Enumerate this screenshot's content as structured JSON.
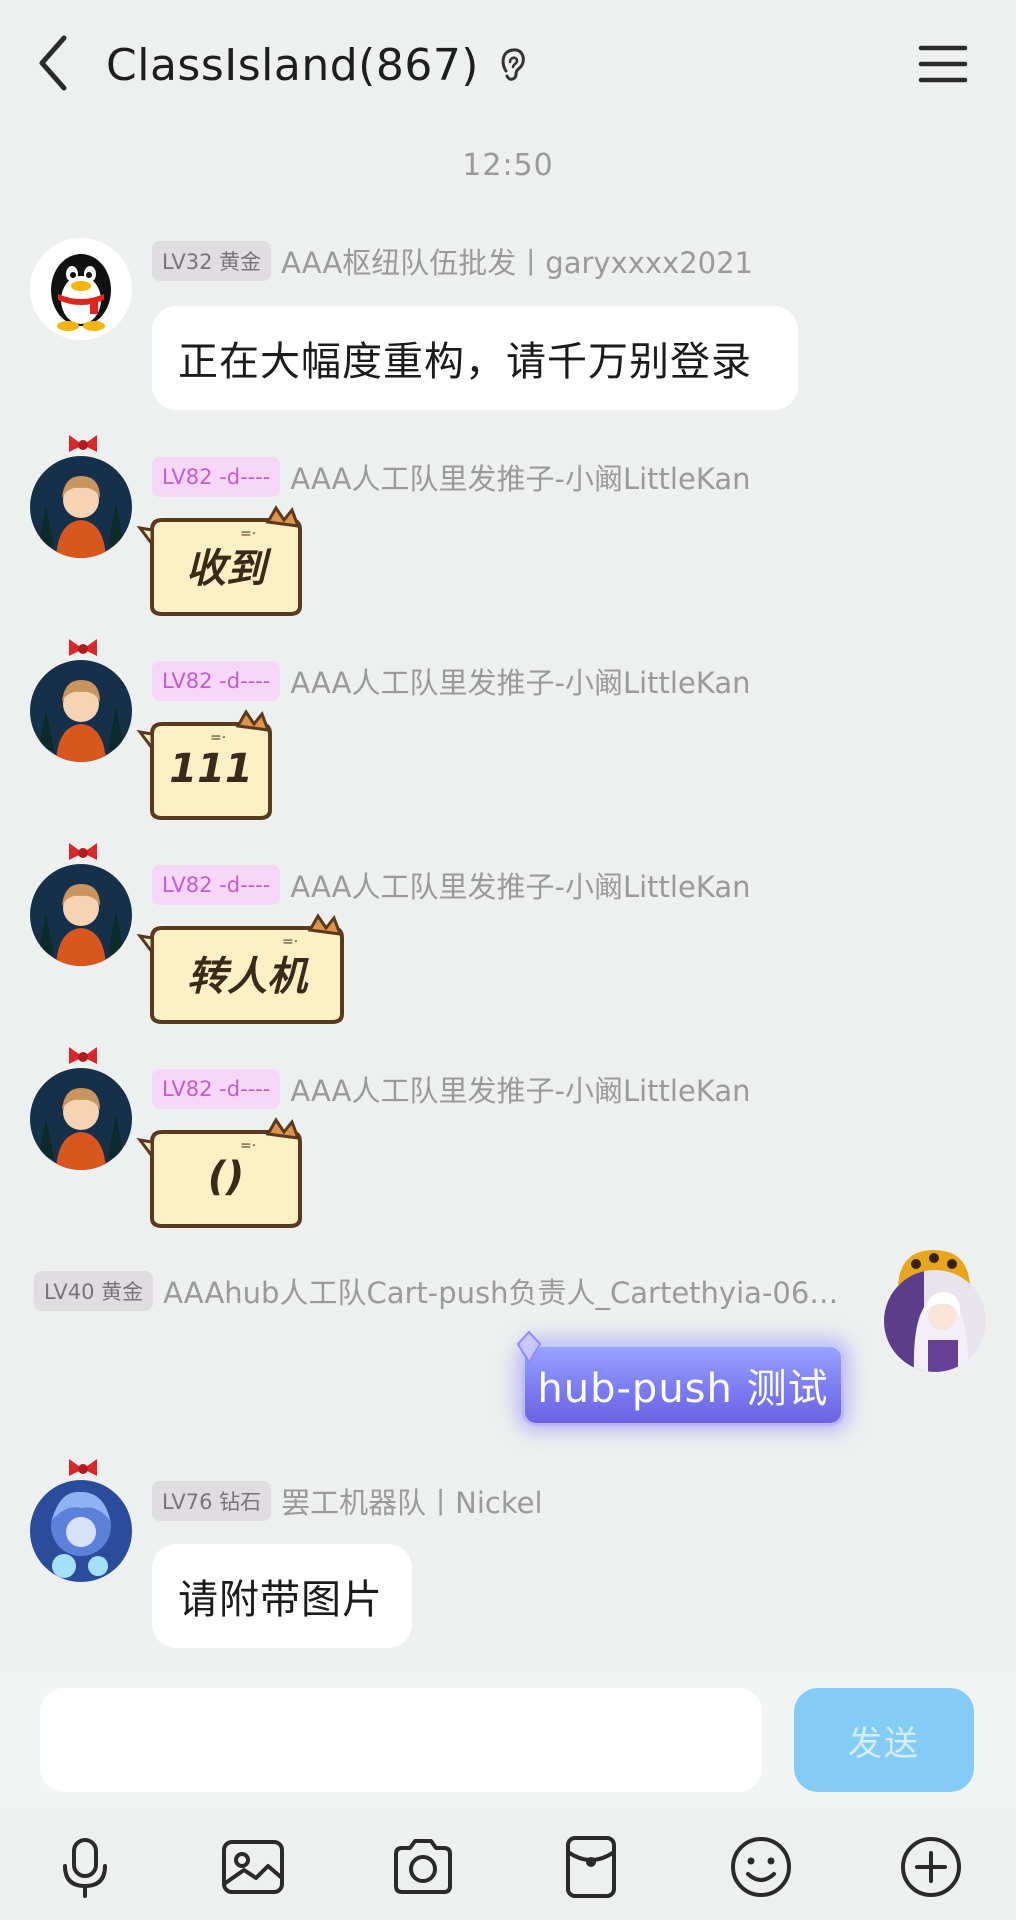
{
  "header": {
    "title": "ClassIsland(867)",
    "back_icon": "chevron-left-icon",
    "ear_icon": "ear-icon",
    "menu_icon": "hamburger-menu-icon"
  },
  "timestamp": "12:50",
  "messages": [
    {
      "level": "LV32 黄金",
      "sender": "AAA枢纽队伍批发丨garyxxxx2021",
      "text": "正在大幅度重构，请千万别登录",
      "avatar": "qq-penguin-avatar"
    },
    {
      "level": "LV82 -d----",
      "sender": "AAA人工队里发推子-小阚LittleKan",
      "text": "收到",
      "avatar": "anime-boy-avatar"
    },
    {
      "level": "LV82 -d----",
      "sender": "AAA人工队里发推子-小阚LittleKan",
      "text": "111",
      "avatar": "anime-boy-avatar"
    },
    {
      "level": "LV82 -d----",
      "sender": "AAA人工队里发推子-小阚LittleKan",
      "text": "转人机",
      "avatar": "anime-boy-avatar"
    },
    {
      "level": "LV82 -d----",
      "sender": "AAA人工队里发推子-小阚LittleKan",
      "text": "()",
      "avatar": "anime-boy-avatar"
    },
    {
      "level": "LV40 黄金",
      "sender": "AAAhub人工队Cart-push负责人_Cartethyia-06…",
      "text": "hub-push 测试",
      "avatar": "anime-girl-avatar"
    },
    {
      "level": "LV76 钻石",
      "sender": "罢工机器队丨Nickel",
      "text": "请附带图片",
      "avatar": "blue-anime-avatar"
    }
  ],
  "input": {
    "value": "",
    "send_label": "发送"
  },
  "toolbar": {
    "icons": [
      "microphone-icon",
      "image-icon",
      "camera-icon",
      "red-packet-icon",
      "emoji-icon",
      "plus-icon"
    ]
  },
  "colors": {
    "background": "#edf0ee",
    "send_button": "#83ccf6",
    "level_pink": "#c45cd2",
    "cat_bubble_fill": "#fdf0c4"
  }
}
